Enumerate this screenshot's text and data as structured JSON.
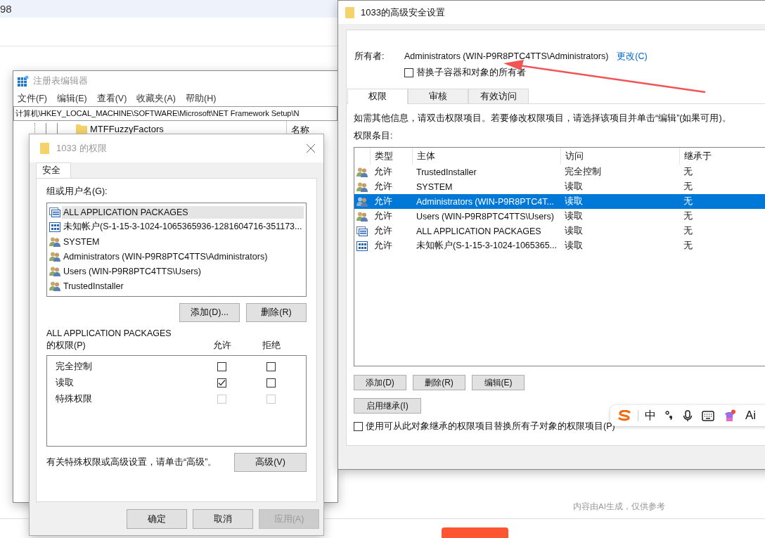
{
  "background_page": {
    "header_text": "98",
    "footer_note": "内容由AI生成，仅供参考"
  },
  "registry_editor": {
    "title": "注册表编辑器",
    "menu": [
      "文件(F)",
      "编辑(E)",
      "查看(V)",
      "收藏夹(A)",
      "帮助(H)"
    ],
    "address": "计算机\\HKEY_LOCAL_MACHINE\\SOFTWARE\\Microsoft\\NET Framework Setup\\N",
    "tree_items": [
      "MTFFuzzyFactors"
    ],
    "list_header": "名称"
  },
  "permissions_dialog": {
    "title": "1033 的权限",
    "tabs": [
      {
        "label": "安全",
        "selected": true
      }
    ],
    "group_label": "组或用户名(G):",
    "principals": [
      {
        "name": "ALL APPLICATION PACKAGES",
        "kind": "package",
        "selected": true
      },
      {
        "name": "未知帐户(S-1-15-3-1024-1065365936-1281604716-351173...",
        "kind": "unknown",
        "selected": false
      },
      {
        "name": "SYSTEM",
        "kind": "group",
        "selected": false
      },
      {
        "name": "Administrators (WIN-P9R8PTC4TTS\\Administrators)",
        "kind": "group",
        "selected": false
      },
      {
        "name": "Users (WIN-P9R8PTC4TTS\\Users)",
        "kind": "group",
        "selected": false
      },
      {
        "name": "TrustedInstaller",
        "kind": "group",
        "selected": false
      }
    ],
    "buttons": [
      "添加(D)...",
      "删除(R)"
    ],
    "permissions_for": "ALL APPLICATION PACKAGES",
    "permissions_label": "的权限(P)",
    "allow_header": "允许",
    "deny_header": "拒绝",
    "permissions": [
      {
        "name": "完全控制",
        "allow": false,
        "deny": false,
        "disabled": false
      },
      {
        "name": "读取",
        "allow": true,
        "deny": false,
        "disabled": false
      },
      {
        "name": "特殊权限",
        "allow": false,
        "deny": false,
        "disabled": true
      }
    ],
    "advanced_hint": "有关特殊权限或高级设置，请单击“高级”。",
    "advanced_button": "高级(V)",
    "footer_buttons": [
      {
        "label": "确定",
        "disabled": false
      },
      {
        "label": "取消",
        "disabled": false
      },
      {
        "label": "应用(A)",
        "disabled": true
      }
    ]
  },
  "advanced_window": {
    "title": "1033的高级安全设置",
    "owner_label": "所有者:",
    "owner": "Administrators (WIN-P9R8PTC4TTS\\Administrators)",
    "change_link": "更改(C)",
    "replace_owner": {
      "label": "替换子容器和对象的所有者",
      "checked": false
    },
    "tabs": [
      {
        "label": "权限",
        "selected": true
      },
      {
        "label": "审核",
        "selected": false
      },
      {
        "label": "有效访问",
        "selected": false
      }
    ],
    "info": "如需其他信息，请双击权限项目。若要修改权限项目，请选择该项目并单击“编辑”(如果可用)。",
    "entries_label": "权限条目:",
    "columns": [
      "类型",
      "主体",
      "访问",
      "继承于"
    ],
    "entries": [
      {
        "kind": "group",
        "type": "允许",
        "principal": "TrustedInstaller",
        "access": "完全控制",
        "inherited_from": "无",
        "selected": false
      },
      {
        "kind": "group",
        "type": "允许",
        "principal": "SYSTEM",
        "access": "读取",
        "inherited_from": "无",
        "selected": false
      },
      {
        "kind": "group",
        "type": "允许",
        "principal": "Administrators (WIN-P9R8PTC4T...",
        "access": "读取",
        "inherited_from": "无",
        "selected": true
      },
      {
        "kind": "group",
        "type": "允许",
        "principal": "Users (WIN-P9R8PTC4TTS\\Users)",
        "access": "读取",
        "inherited_from": "无",
        "selected": false
      },
      {
        "kind": "package",
        "type": "允许",
        "principal": "ALL APPLICATION PACKAGES",
        "access": "读取",
        "inherited_from": "无",
        "selected": false
      },
      {
        "kind": "unknown",
        "type": "允许",
        "principal": "未知帐户(S-1-15-3-1024-1065365...",
        "access": "读取",
        "inherited_from": "无",
        "selected": false
      }
    ],
    "buttons": [
      "添加(D)",
      "删除(R)",
      "编辑(E)"
    ],
    "inherit_button": "启用继承(I)",
    "replace_children": {
      "label": "使用可从此对象继承的权限项目替换所有子对象的权限项目(P)",
      "checked": false
    }
  },
  "ime_toolbar": {
    "mode": "中",
    "ai_label": "Ai"
  }
}
